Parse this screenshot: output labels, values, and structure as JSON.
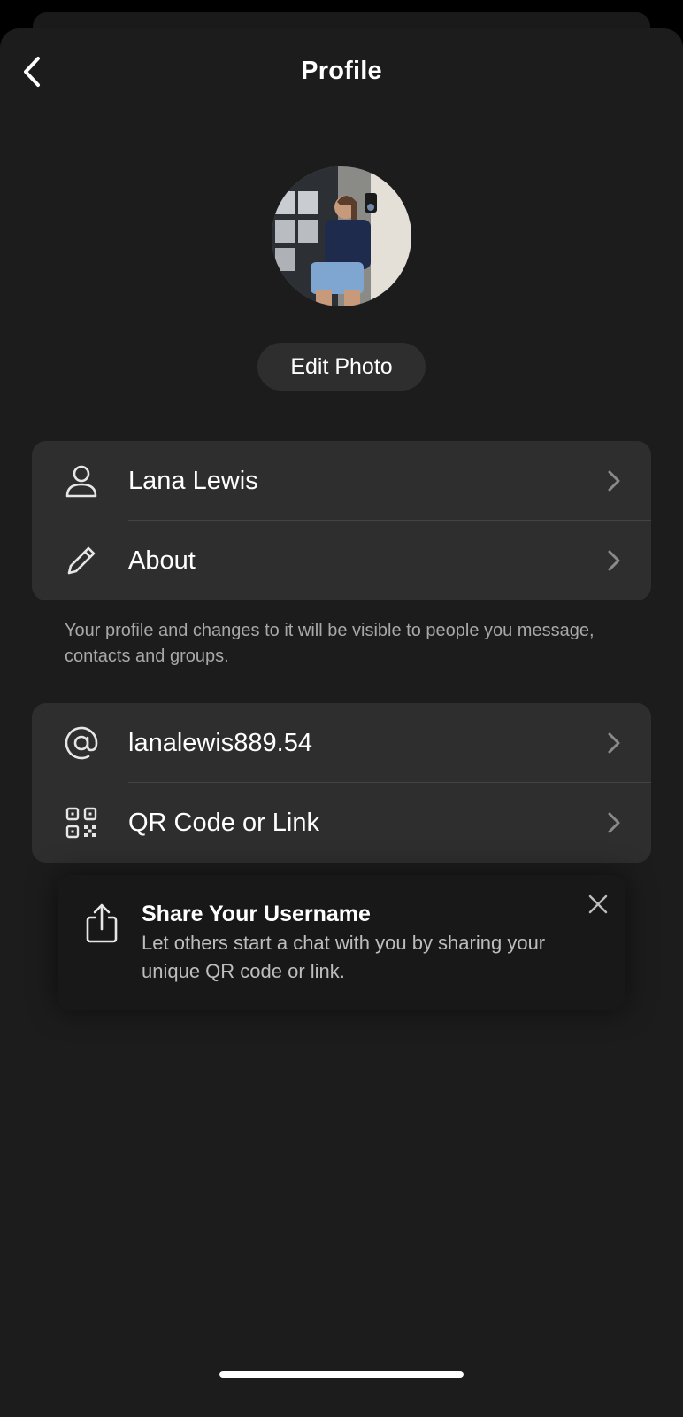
{
  "header": {
    "title": "Profile",
    "back_icon": "chevron-left-icon"
  },
  "profile": {
    "avatar_alt": "profile photo",
    "edit_photo_label": "Edit Photo"
  },
  "info_card": {
    "rows": [
      {
        "icon": "person-icon",
        "label": "Lana Lewis"
      },
      {
        "icon": "pencil-icon",
        "label": "About"
      }
    ]
  },
  "helper_text": "Your profile and changes to it will be visible to people you message, contacts and groups.",
  "username_card": {
    "rows": [
      {
        "icon": "at-sign-icon",
        "label": "lanalewis889.54"
      },
      {
        "icon": "qr-code-icon",
        "label": "QR Code or Link"
      }
    ]
  },
  "share_tip": {
    "icon": "share-icon",
    "title": "Share Your Username",
    "description": "Let others start a chat with you by sharing your unique QR code or link.",
    "close_icon": "close-icon"
  },
  "colors": {
    "background": "#1c1c1c",
    "card": "#2e2e2e",
    "text": "#ffffff",
    "secondary_text": "#a8a8a8"
  }
}
